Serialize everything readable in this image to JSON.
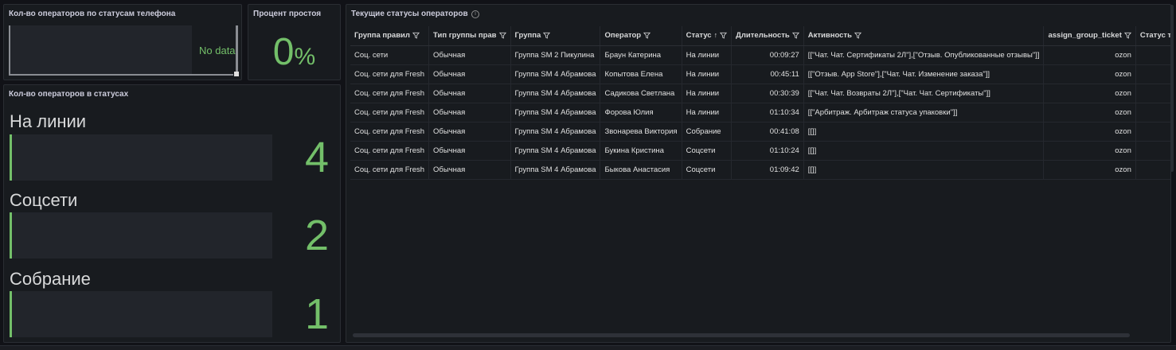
{
  "phone_status_panel": {
    "title": "Кол-во операторов по статусам телефона",
    "no_data": "No data"
  },
  "idle_panel": {
    "title": "Процент простоя",
    "value": "0",
    "unit": "%"
  },
  "statuses_panel": {
    "title": "Кол-во операторов в статусах",
    "items": [
      {
        "label": "На линии",
        "value": "4",
        "fill_fraction": 0.01
      },
      {
        "label": "Соцсети",
        "value": "2",
        "fill_fraction": 0.01
      },
      {
        "label": "Собрание",
        "value": "1",
        "fill_fraction": 0.005
      }
    ]
  },
  "table_panel": {
    "title": "Текущие статусы операторов",
    "info_icon": "info-icon",
    "columns": [
      {
        "label": "Группа правил",
        "filter": true
      },
      {
        "label": "Тип группы прав",
        "filter": true
      },
      {
        "label": "Группа",
        "filter": true
      },
      {
        "label": "Оператор",
        "filter": true
      },
      {
        "label": "Статус",
        "filter": true,
        "sort": "asc"
      },
      {
        "label": "Длительность",
        "filter": true
      },
      {
        "label": "Активность",
        "filter": true
      },
      {
        "label": "assign_group_ticket",
        "filter": true
      },
      {
        "label": "Статус телефона",
        "filter": false
      }
    ],
    "rows": [
      [
        "Соц. сети",
        "Обычная",
        "Группа SM 2 Пикулина",
        "Браун Катерина",
        "На линии",
        "00:09:27",
        "[[\"Чат. Чат. Сертификаты 2Л\"],[\"Отзыв. Опубликованные отзывы\"]]",
        "ozon",
        ""
      ],
      [
        "Соц. сети для Fresh",
        "Обычная",
        "Группа SM 4 Абрамова",
        "Копытова Елена",
        "На линии",
        "00:45:11",
        "[[\"Отзыв. App Store\"],[\"Чат. Чат. Изменение заказа\"]]",
        "ozon",
        ""
      ],
      [
        "Соц. сети для Fresh",
        "Обычная",
        "Группа SM 4 Абрамова",
        "Садикова Светлана",
        "На линии",
        "00:30:39",
        "[[\"Чат. Чат. Возвраты 2Л\"],[\"Чат. Чат. Сертификаты\"]]",
        "ozon",
        ""
      ],
      [
        "Соц. сети для Fresh",
        "Обычная",
        "Группа SM 4 Абрамова",
        "Форова Юлия",
        "На линии",
        "01:10:34",
        "[[\"Арбитраж. Арбитраж статуса упаковки\"]]",
        "ozon",
        ""
      ],
      [
        "Соц. сети для Fresh",
        "Обычная",
        "Группа SM 4 Абрамова",
        "Звонарева Виктория",
        "Собрание",
        "00:41:08",
        "[[]]",
        "ozon",
        ""
      ],
      [
        "Соц. сети для Fresh",
        "Обычная",
        "Группа SM 4 Абрамова",
        "Букина Кристина",
        "Соцсети",
        "01:10:24",
        "[[]]",
        "ozon",
        ""
      ],
      [
        "Соц. сети для Fresh",
        "Обычная",
        "Группа SM 4 Абрамова",
        "Быкова Анастасия",
        "Соцсети",
        "01:09:42",
        "[[]]",
        "ozon",
        ""
      ]
    ]
  },
  "colors": {
    "accent_green": "#73bf69",
    "panel_bg": "#181b1f",
    "page_bg": "#111217"
  }
}
